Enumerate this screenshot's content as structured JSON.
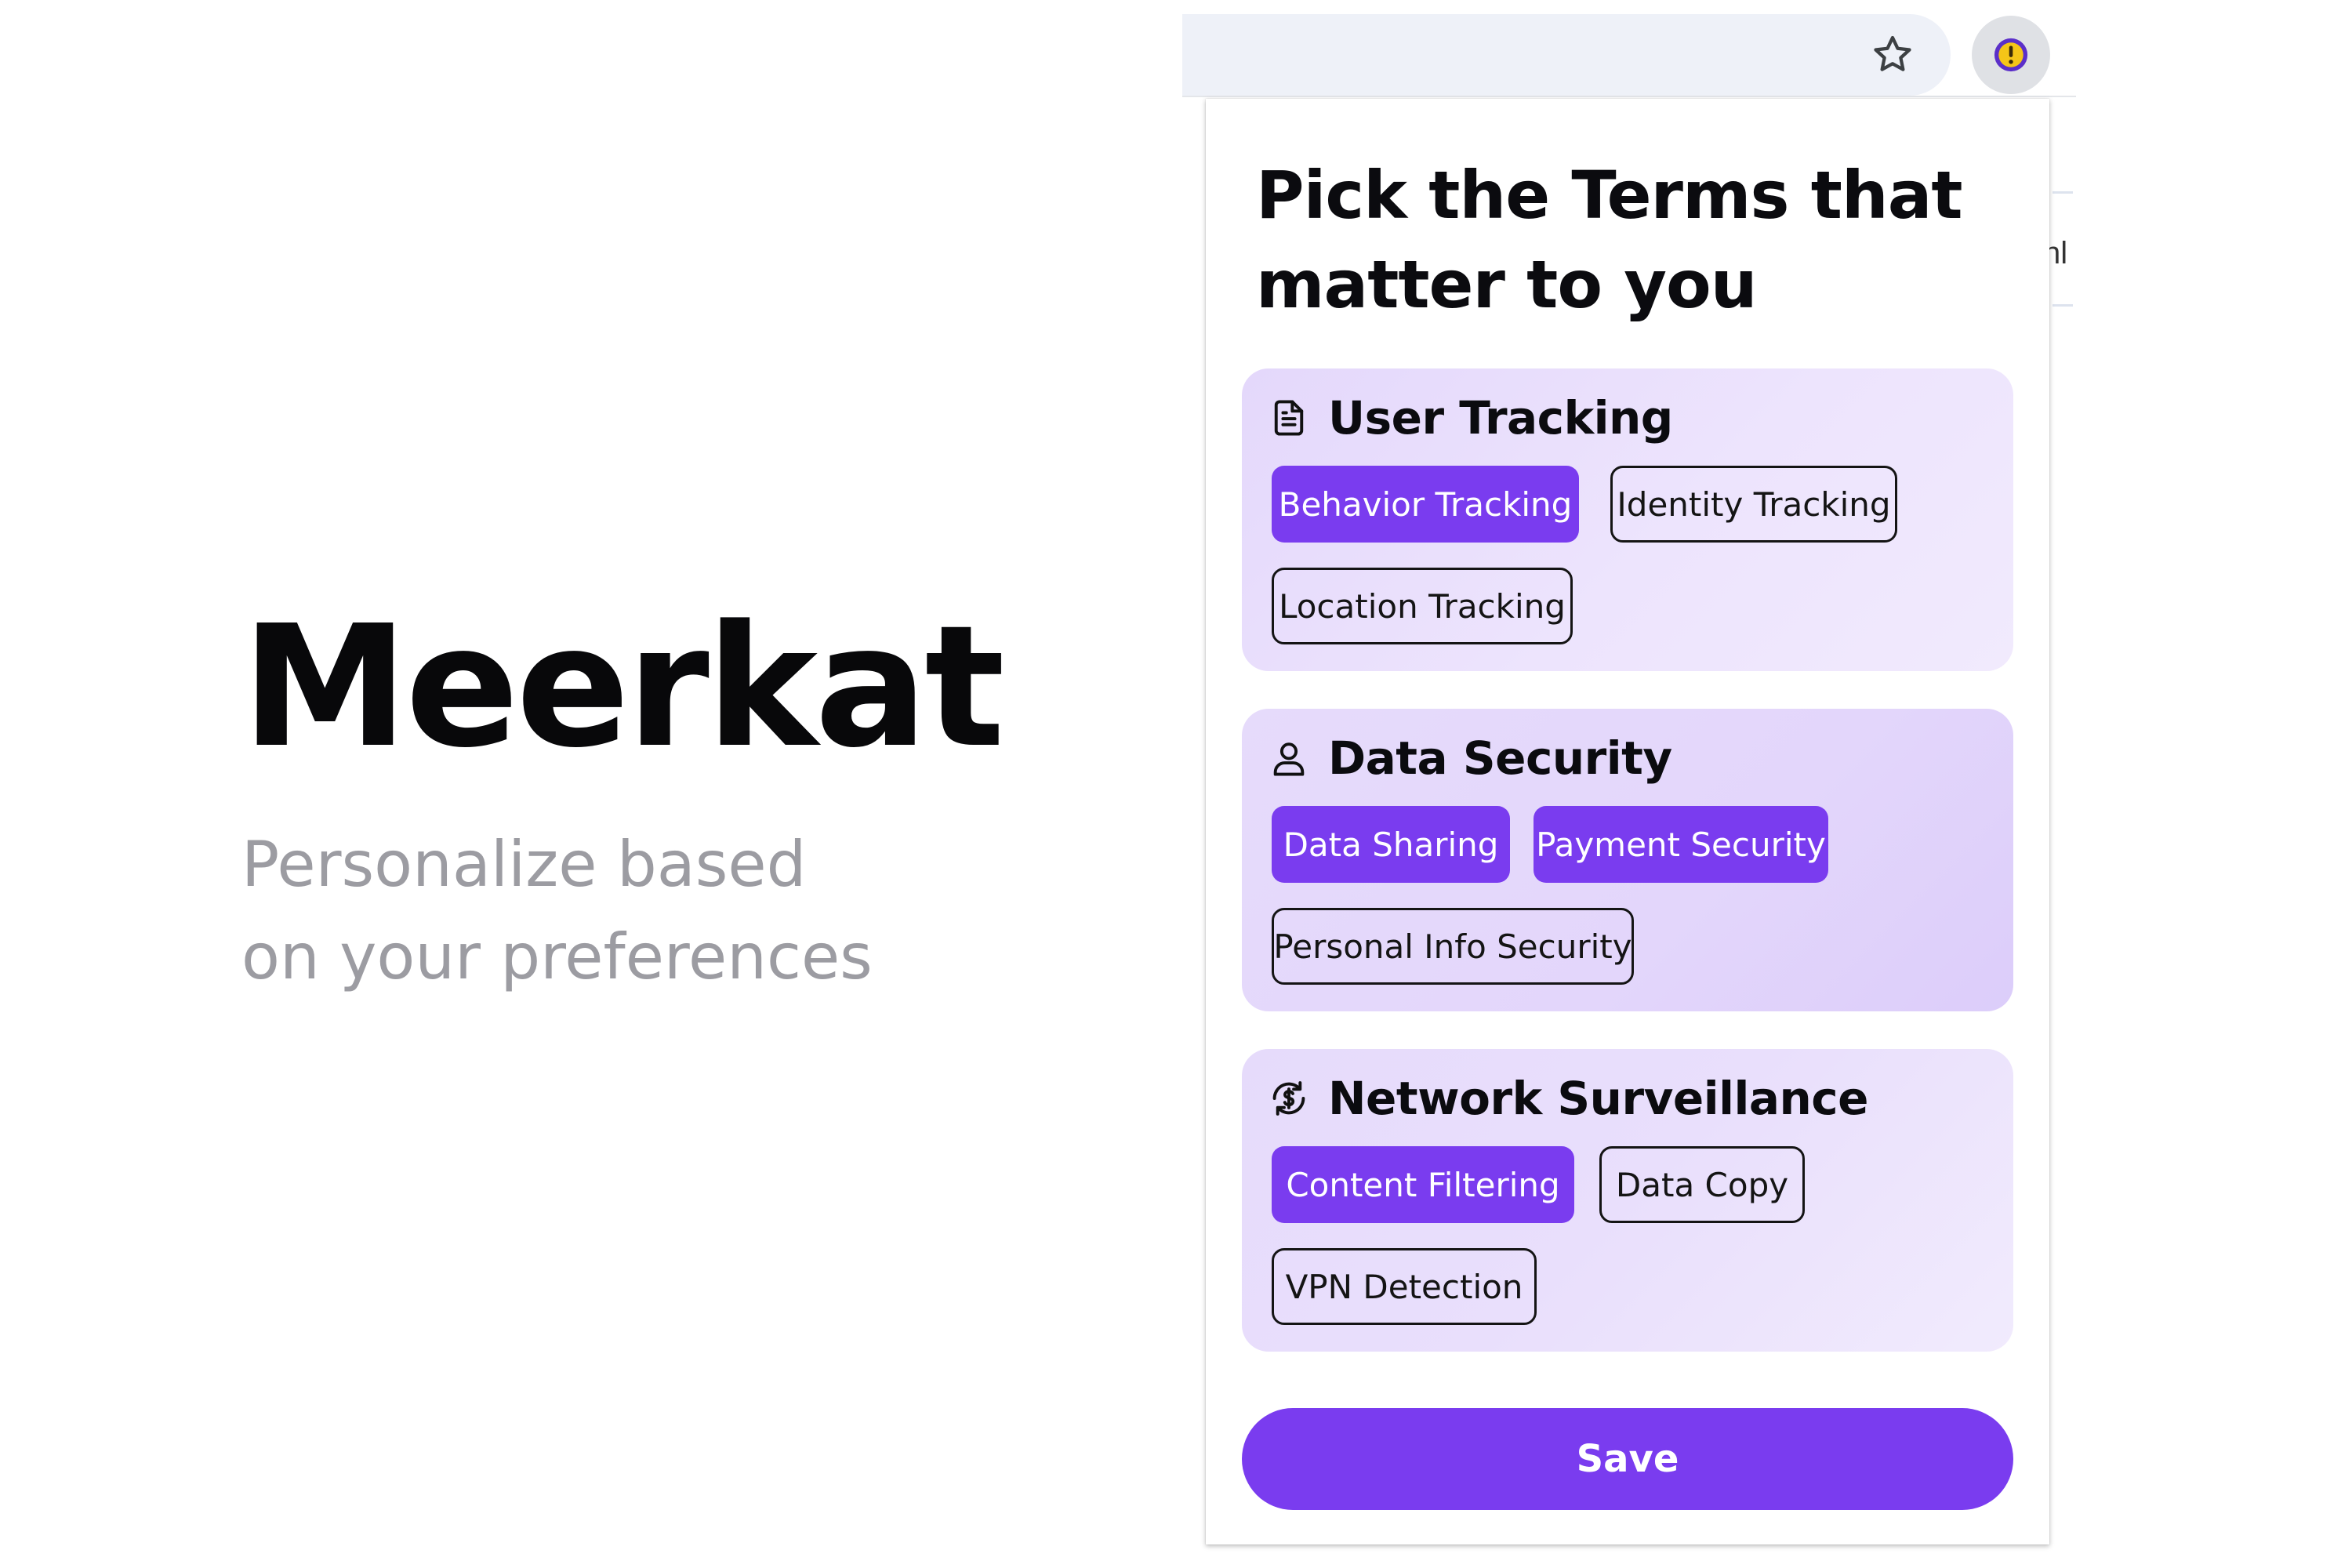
{
  "hero": {
    "title": "Meerkat",
    "subtitle": "Personalize based on your preferences"
  },
  "browser": {
    "bookmark_icon": "star-outline-icon",
    "extension_icon": "meerkat-alert-icon",
    "underlying_page_fragment": "nl"
  },
  "popup": {
    "title": "Pick the Terms that matter to you",
    "sections": [
      {
        "icon": "document-icon",
        "title": "User Tracking",
        "terms": [
          {
            "label": "Behavior Tracking",
            "selected": true
          },
          {
            "label": "Identity Tracking",
            "selected": false
          },
          {
            "label": "Location Tracking",
            "selected": false
          }
        ]
      },
      {
        "icon": "user-icon",
        "title": "Data Security",
        "terms": [
          {
            "label": "Data Sharing",
            "selected": true
          },
          {
            "label": "Payment Security",
            "selected": true
          },
          {
            "label": "Personal Info Security",
            "selected": false
          }
        ]
      },
      {
        "icon": "dollar-sync-icon",
        "title": "Network Surveillance",
        "terms": [
          {
            "label": "Content Filtering",
            "selected": true
          },
          {
            "label": "Data Copy",
            "selected": false
          },
          {
            "label": "VPN Detection",
            "selected": false
          }
        ]
      }
    ],
    "save_label": "Save"
  },
  "colors": {
    "accent": "#7a3cef",
    "section_bg": "#e9dffc",
    "hero_subtitle": "#9c9ca2",
    "extension_badge": "#f5c518"
  }
}
